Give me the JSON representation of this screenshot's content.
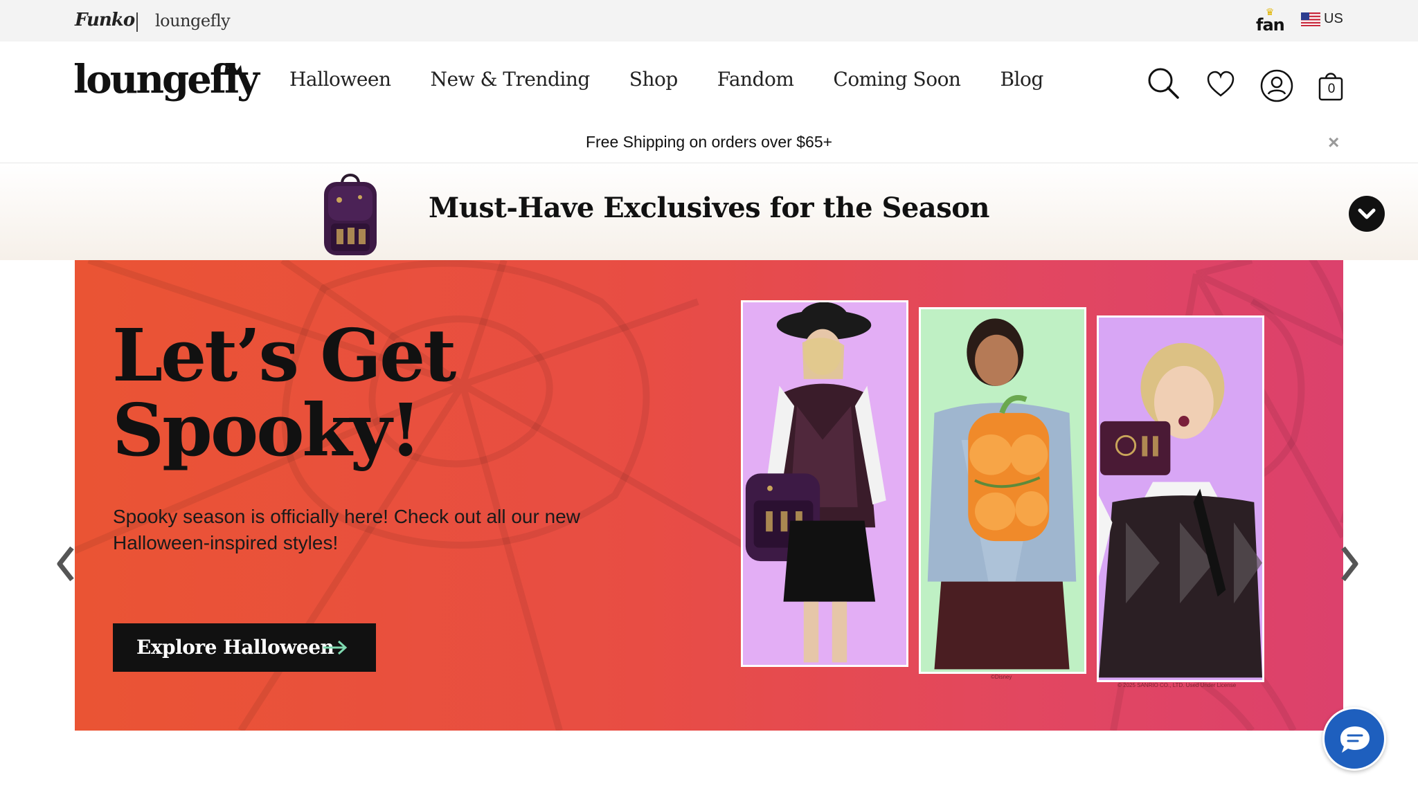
{
  "utility_bar": {
    "funko_logo": "Funko",
    "loungefly_logo": "loungefly",
    "fan_logo": "fan",
    "country": "US"
  },
  "header": {
    "logo": "loungefly",
    "nav": [
      "Halloween",
      "New & Trending",
      "Shop",
      "Fandom",
      "Coming Soon",
      "Blog"
    ],
    "cart_count": "0",
    "icons": [
      "search-icon",
      "heart-icon",
      "account-icon",
      "cart-icon"
    ]
  },
  "shipping_banner": {
    "text": "Free Shipping on orders over $65+",
    "close": "×"
  },
  "promo": {
    "title": "Must-Have Exclusives for the Season"
  },
  "hero": {
    "title_line1": "Let’s Get",
    "title_line2": "Spooky!",
    "subtitle": "Spooky season is officially here! Check out all our new Halloween-inspired styles!",
    "cta": "Explore Halloween",
    "credits": [
      "©Disney",
      "© 2025 SANRIO CO., LTD. Used Under License"
    ]
  },
  "colors": {
    "hero_start": "#ea5434",
    "hero_end": "#dc416c",
    "cta_bg": "#111111",
    "cta_arrow": "#7fd9b0",
    "chat_bg": "#1e5fbe"
  }
}
